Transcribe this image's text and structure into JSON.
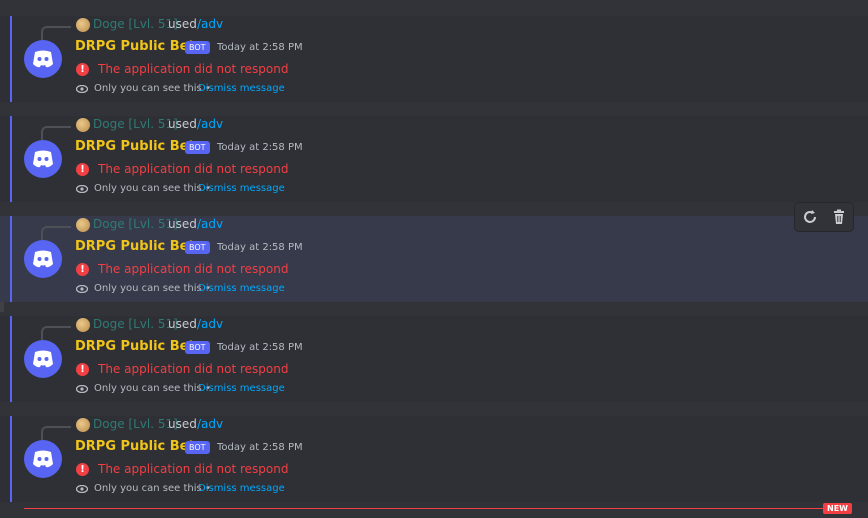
{
  "messages": [
    {
      "reply_name": "Doge [Lvl. 51]",
      "reply_used": "used",
      "reply_command": "/adv",
      "author": "DRPG Public Beta",
      "bot_tag": "BOT",
      "timestamp": "Today at 2:58 PM",
      "error_text": "The application did not respond",
      "ephemeral_note": "Only you can see this •",
      "dismiss_label": "Dismiss message"
    },
    {
      "reply_name": "Doge [Lvl. 51]",
      "reply_used": "used",
      "reply_command": "/adv",
      "author": "DRPG Public Beta",
      "bot_tag": "BOT",
      "timestamp": "Today at 2:58 PM",
      "error_text": "The application did not respond",
      "ephemeral_note": "Only you can see this •",
      "dismiss_label": "Dismiss message"
    },
    {
      "reply_name": "Doge [Lvl. 51]",
      "reply_used": "used",
      "reply_command": "/adv",
      "author": "DRPG Public Beta",
      "bot_tag": "BOT",
      "timestamp": "Today at 2:58 PM",
      "error_text": "The application did not respond",
      "ephemeral_note": "Only you can see this •",
      "dismiss_label": "Dismiss message"
    },
    {
      "reply_name": "Doge [Lvl. 51]",
      "reply_used": "used",
      "reply_command": "/adv",
      "author": "DRPG Public Beta",
      "bot_tag": "BOT",
      "timestamp": "Today at 2:58 PM",
      "error_text": "The application did not respond",
      "ephemeral_note": "Only you can see this •",
      "dismiss_label": "Dismiss message"
    },
    {
      "reply_name": "Doge [Lvl. 51]",
      "reply_used": "used",
      "reply_command": "/adv",
      "author": "DRPG Public Beta",
      "bot_tag": "BOT",
      "timestamp": "Today at 2:58 PM",
      "error_text": "The application did not respond",
      "ephemeral_note": "Only you can see this •",
      "dismiss_label": "Dismiss message"
    }
  ],
  "hovered_message": 3,
  "toolbar": {
    "icons": [
      "retry-icon",
      "trash-icon"
    ]
  },
  "new_divider": {
    "badge": "NEW"
  },
  "colors": {
    "background": "#313338",
    "message_bg": "#2e3036",
    "hover_bg": "#363a4b",
    "accent": "#5865f2",
    "error": "#f23f43",
    "link": "#00a8fc",
    "bot_name": "#f0c419",
    "reply_name": "#2f7b73"
  }
}
